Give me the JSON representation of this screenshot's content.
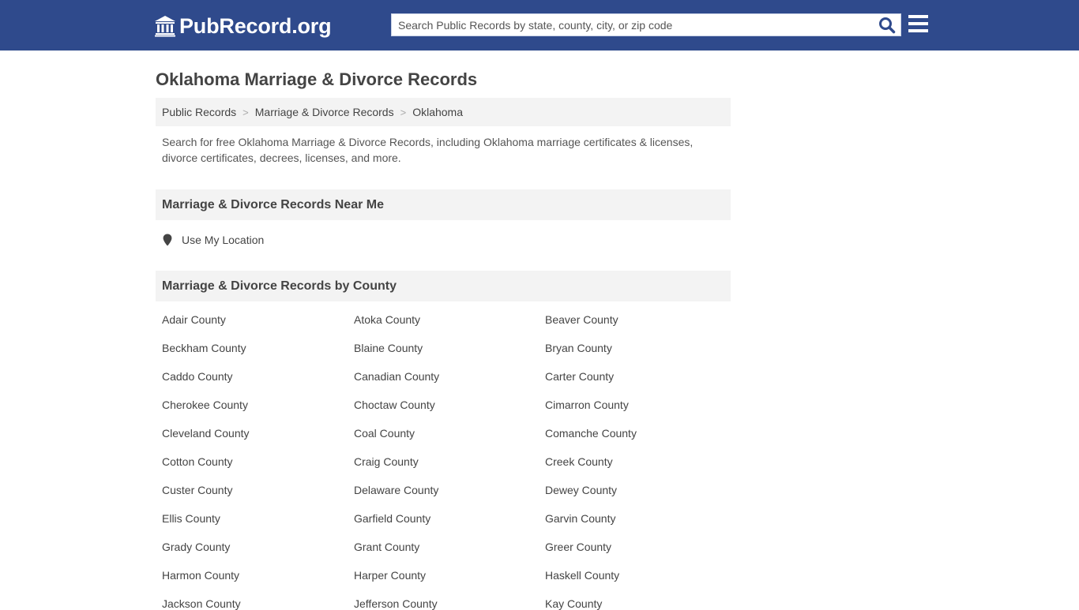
{
  "header": {
    "logo_text": "PubRecord.org",
    "search_placeholder": "Search Public Records by state, county, city, or zip code",
    "brand_color": "#2f4a8c",
    "search_icon": "magnifier-icon",
    "menu_icon": "hamburger-icon",
    "logo_icon": "courthouse-icon"
  },
  "page": {
    "title": "Oklahoma Marriage & Divorce Records",
    "breadcrumb": [
      "Public Records",
      "Marriage & Divorce Records",
      "Oklahoma"
    ],
    "breadcrumb_separator": ">",
    "intro": "Search for free Oklahoma Marriage & Divorce Records, including Oklahoma marriage certificates & licenses, divorce certificates, decrees, licenses, and more."
  },
  "near_me": {
    "heading": "Marriage & Divorce Records Near Me",
    "location_label": "Use My Location",
    "icon": "map-pin-icon"
  },
  "by_county": {
    "heading": "Marriage & Divorce Records by County",
    "counties": [
      "Adair County",
      "Atoka County",
      "Beaver County",
      "Beckham County",
      "Blaine County",
      "Bryan County",
      "Caddo County",
      "Canadian County",
      "Carter County",
      "Cherokee County",
      "Choctaw County",
      "Cimarron County",
      "Cleveland County",
      "Coal County",
      "Comanche County",
      "Cotton County",
      "Craig County",
      "Creek County",
      "Custer County",
      "Delaware County",
      "Dewey County",
      "Ellis County",
      "Garfield County",
      "Garvin County",
      "Grady County",
      "Grant County",
      "Greer County",
      "Harmon County",
      "Harper County",
      "Haskell County",
      "Jackson County",
      "Jefferson County",
      "Kay County"
    ]
  }
}
